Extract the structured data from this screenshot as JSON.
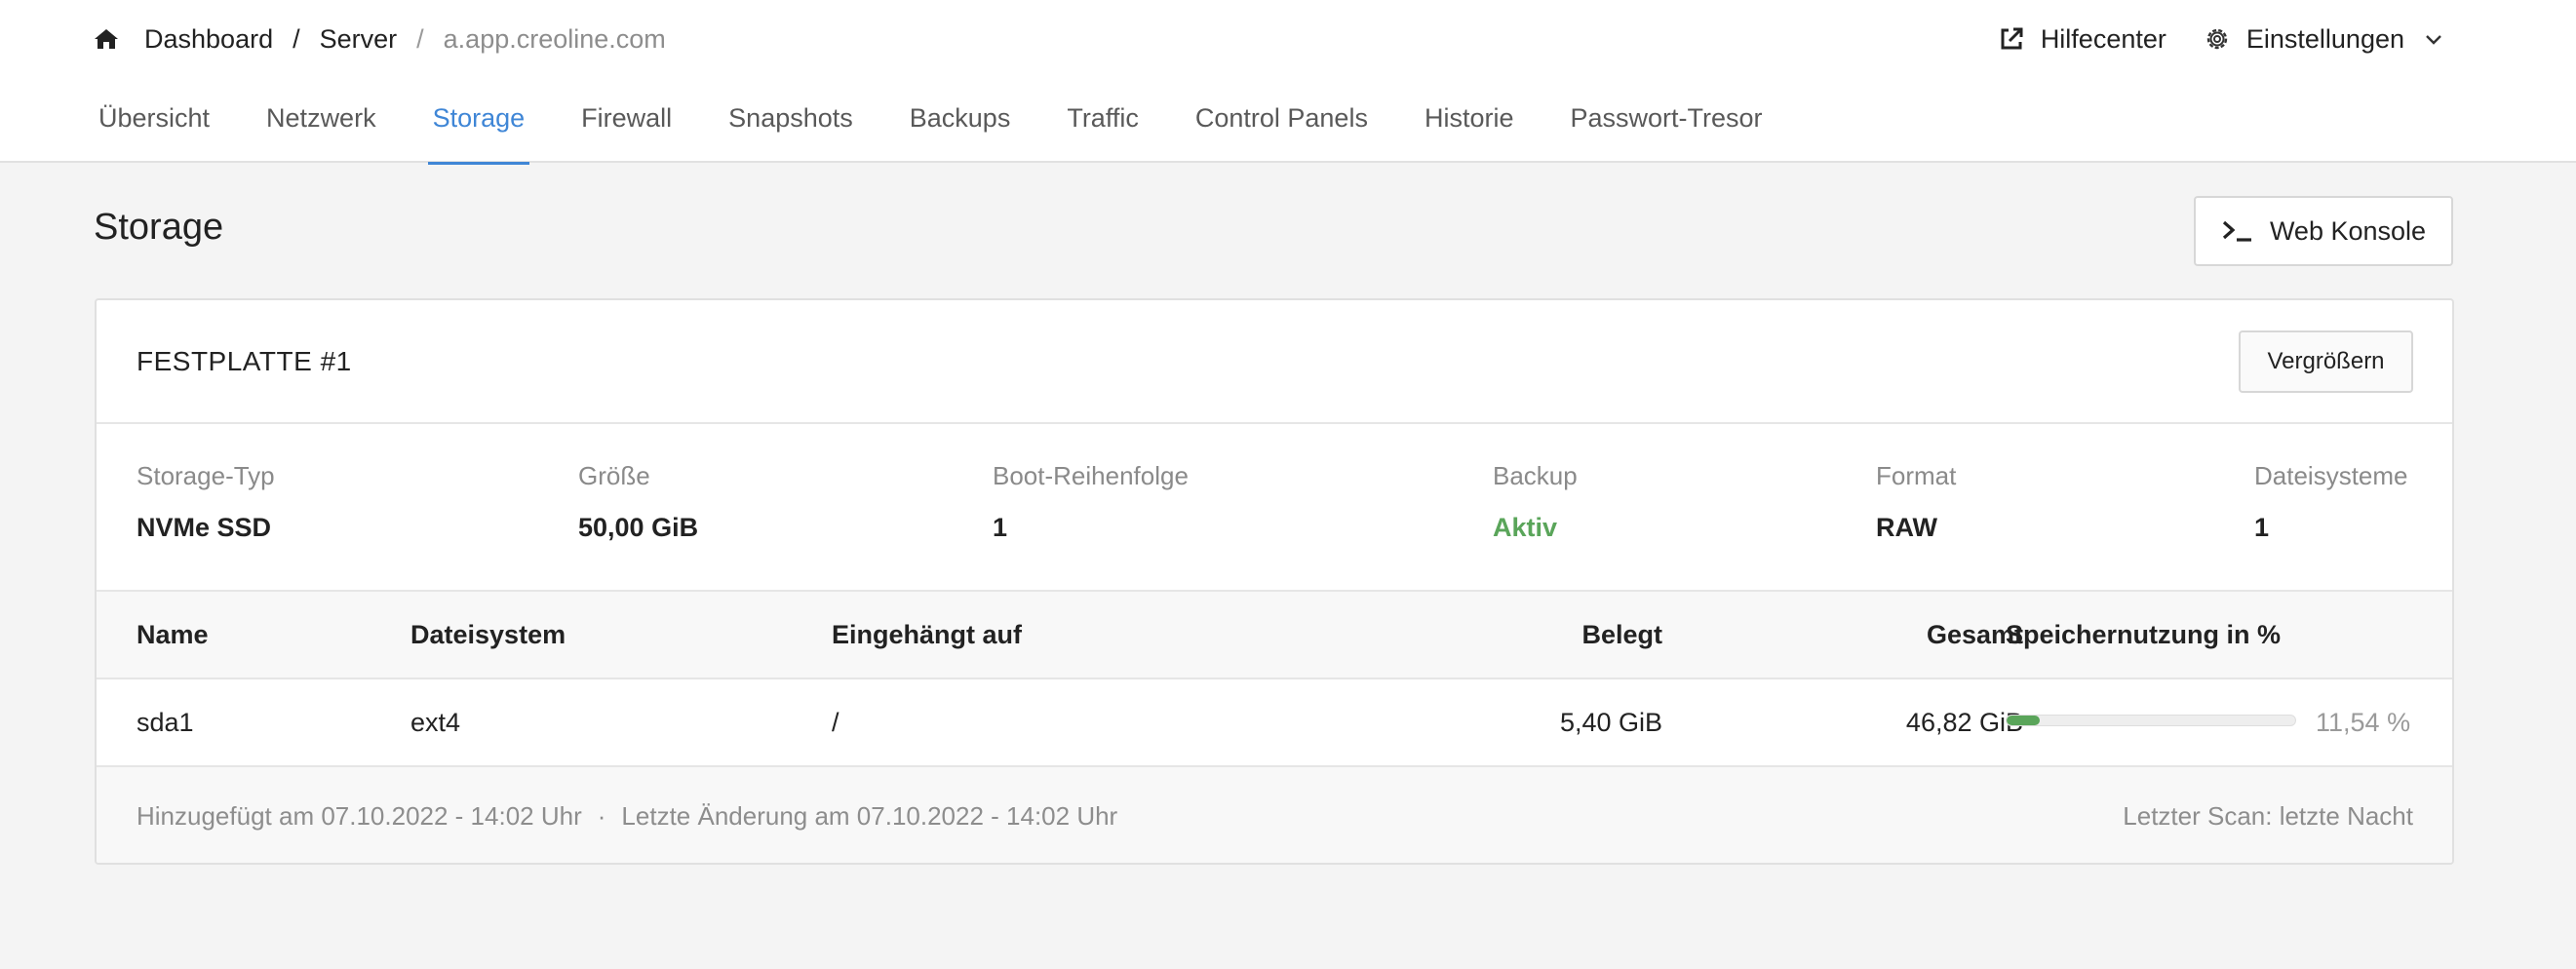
{
  "colors": {
    "accent": "#3f86d6",
    "success": "#5aa55a",
    "muted_text": "#8d8d8d"
  },
  "breadcrumb": {
    "home_icon": "home-icon",
    "items": [
      "Dashboard",
      "Server",
      "a.app.creoline.com"
    ]
  },
  "header": {
    "help_label": "Hilfecenter",
    "help_icon": "external-link-icon",
    "settings_label": "Einstellungen",
    "settings_icon": "gear-icon",
    "settings_chevron_icon": "chevron-down-icon"
  },
  "tabs": [
    {
      "label": "Übersicht",
      "active": false
    },
    {
      "label": "Netzwerk",
      "active": false
    },
    {
      "label": "Storage",
      "active": true
    },
    {
      "label": "Firewall",
      "active": false
    },
    {
      "label": "Snapshots",
      "active": false
    },
    {
      "label": "Backups",
      "active": false
    },
    {
      "label": "Traffic",
      "active": false
    },
    {
      "label": "Control Panels",
      "active": false
    },
    {
      "label": "Historie",
      "active": false
    },
    {
      "label": "Passwort-Tresor",
      "active": false
    }
  ],
  "page": {
    "title": "Storage",
    "console_button": "Web Konsole",
    "console_icon": "terminal-icon"
  },
  "disk": {
    "title": "FESTPLATTE #1",
    "resize_button": "Vergrößern",
    "properties": [
      {
        "label": "Storage-Typ",
        "value": "NVMe SSD"
      },
      {
        "label": "Größe",
        "value": "50,00 GiB"
      },
      {
        "label": "Boot-Reihenfolge",
        "value": "1"
      },
      {
        "label": "Backup",
        "value": "Aktiv"
      },
      {
        "label": "Format",
        "value": "RAW"
      },
      {
        "label": "Dateisysteme",
        "value": "1"
      }
    ],
    "table": {
      "headers": [
        "Name",
        "Dateisystem",
        "Eingehängt auf",
        "Belegt",
        "Gesamt",
        "Speichernutzung in %"
      ],
      "rows": [
        {
          "name": "sda1",
          "filesystem": "ext4",
          "mount": "/",
          "used": "5,40 GiB",
          "total": "46,82 GiB",
          "usage_percent_label": "11,54 %",
          "usage_fraction": 0.1154
        }
      ]
    },
    "footer": {
      "added": "Hinzugefügt am 07.10.2022 - 14:02 Uhr",
      "separator": "·",
      "changed": "Letzte Änderung am 07.10.2022 - 14:02 Uhr",
      "last_scan": "Letzter Scan: letzte Nacht"
    }
  }
}
